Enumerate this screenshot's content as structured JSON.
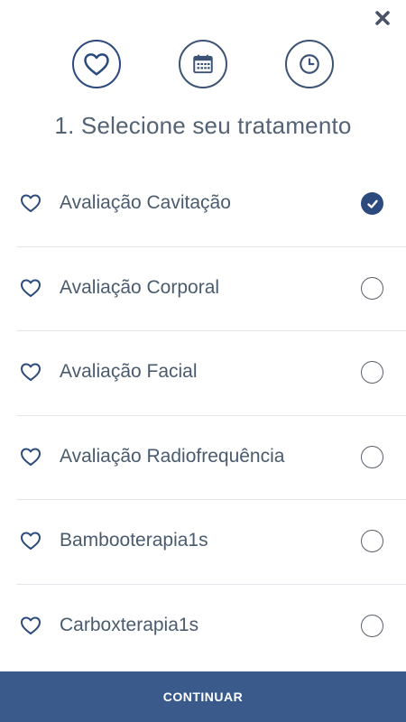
{
  "header": {
    "close_icon": "close-icon",
    "steps": [
      {
        "icon": "heart-icon",
        "active": true
      },
      {
        "icon": "calendar-icon",
        "active": false
      },
      {
        "icon": "clock-icon",
        "active": false
      }
    ]
  },
  "main": {
    "title": "1. Selecione seu tratamento",
    "treatments": [
      {
        "label": "Avaliação Cavitação",
        "selected": true
      },
      {
        "label": "Avaliação Corporal",
        "selected": false
      },
      {
        "label": "Avaliação Facial",
        "selected": false
      },
      {
        "label": "Avaliação Radiofrequência",
        "selected": false
      },
      {
        "label": "Bambooterapia1s",
        "selected": false
      },
      {
        "label": "Carboxterapia1s",
        "selected": false
      }
    ]
  },
  "footer": {
    "continue_label": "CONTINUAR"
  },
  "colors": {
    "accent": "#2c4a7e",
    "button_bg": "#3a5a8c",
    "text": "#4a5b6e"
  }
}
